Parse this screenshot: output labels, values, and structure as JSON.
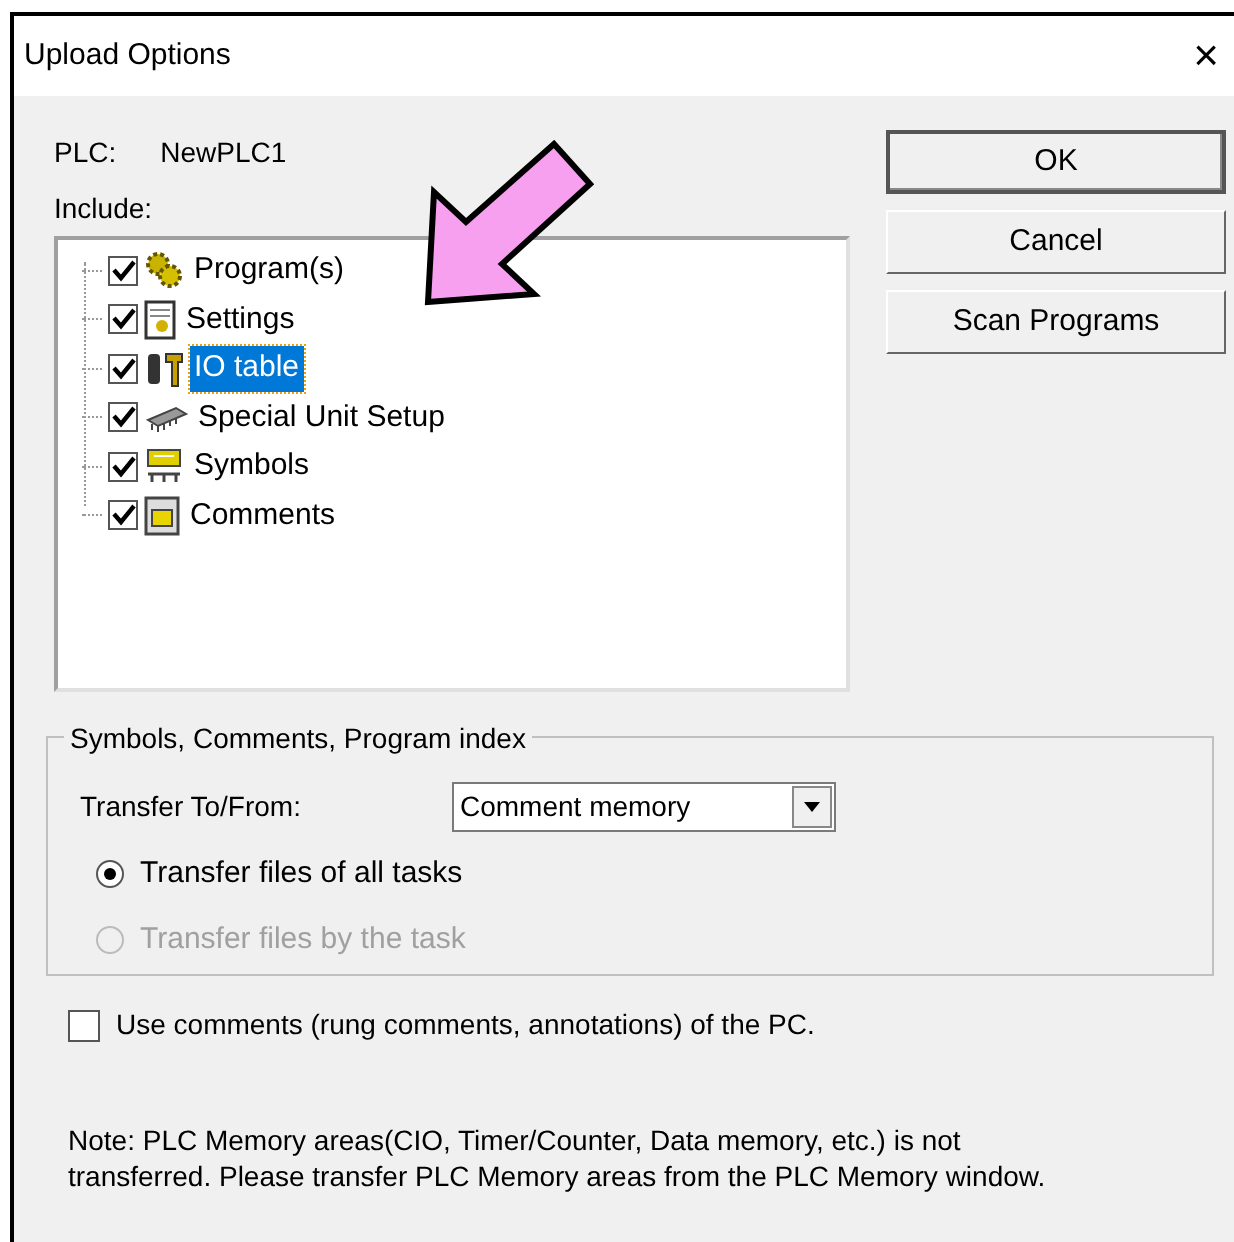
{
  "window": {
    "title": "Upload Options",
    "close": "×"
  },
  "plc": {
    "label": "PLC:",
    "value": "NewPLC1"
  },
  "include": {
    "label": "Include:",
    "items": [
      {
        "label": "Program(s)",
        "checked": true,
        "selected": false,
        "kind": "program"
      },
      {
        "label": "Settings",
        "checked": true,
        "selected": false,
        "kind": "settings"
      },
      {
        "label": "IO table",
        "checked": true,
        "selected": true,
        "kind": "io"
      },
      {
        "label": "Special Unit Setup",
        "checked": true,
        "selected": false,
        "kind": "chip"
      },
      {
        "label": "Symbols",
        "checked": true,
        "selected": false,
        "kind": "symbols"
      },
      {
        "label": "Comments",
        "checked": true,
        "selected": false,
        "kind": "comments"
      }
    ]
  },
  "buttons": [
    {
      "label": "OK",
      "default": true
    },
    {
      "label": "Cancel",
      "default": false
    },
    {
      "label": "Scan Programs",
      "default": false
    }
  ],
  "group": {
    "title": "Symbols, Comments, Program index",
    "transfer_label": "Transfer To/From:",
    "dropdown_value": "Comment memory",
    "radios": [
      {
        "label": "Transfer files of all tasks",
        "selected": true,
        "disabled": false
      },
      {
        "label": "Transfer files by the task",
        "selected": false,
        "disabled": true
      }
    ]
  },
  "use_comments": {
    "label": "Use comments (rung comments, annotations) of the PC.",
    "checked": false
  },
  "note": "Note: PLC Memory areas(CIO, Timer/Counter, Data memory, etc.) is not transferred. Please transfer PLC Memory areas from the PLC Memory window."
}
